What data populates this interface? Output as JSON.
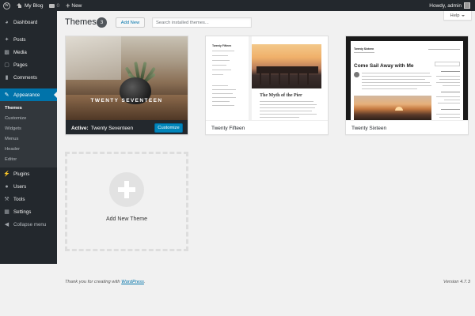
{
  "adminbar": {
    "site_name": "My Blog",
    "comments_count": "0",
    "new_label": "New",
    "greeting": "Howdy, admin"
  },
  "sidebar": {
    "items": [
      {
        "label": "Dashboard",
        "icon": "dashboard-icon"
      },
      {
        "label": "Posts",
        "icon": "pin-icon"
      },
      {
        "label": "Media",
        "icon": "media-icon"
      },
      {
        "label": "Pages",
        "icon": "page-icon"
      },
      {
        "label": "Comments",
        "icon": "comment-icon"
      },
      {
        "label": "Appearance",
        "icon": "brush-icon"
      },
      {
        "label": "Plugins",
        "icon": "plug-icon"
      },
      {
        "label": "Users",
        "icon": "users-icon"
      },
      {
        "label": "Tools",
        "icon": "wrench-icon"
      },
      {
        "label": "Settings",
        "icon": "settings-icon"
      },
      {
        "label": "Collapse menu",
        "icon": "collapse-icon"
      }
    ],
    "appearance_sub": [
      "Themes",
      "Customize",
      "Widgets",
      "Menus",
      "Header",
      "Editor"
    ]
  },
  "help": {
    "label": "Help"
  },
  "header": {
    "title": "Themes",
    "count": "3",
    "add_new_label": "Add New",
    "search_placeholder": "Search installed themes..."
  },
  "themes": [
    {
      "name": "Twenty Seventeen",
      "active_label": "Active:",
      "customize_label": "Customize",
      "screenshot_title": "TWENTY SEVENTEEN"
    },
    {
      "name": "Twenty Fifteen",
      "screenshot_post_title": "The Myth of the Pier",
      "screenshot_site_title": "Twenty Fifteen"
    },
    {
      "name": "Twenty Sixteen",
      "screenshot_post_title": "Come Sail Away with Me",
      "screenshot_site_title": "Twenty Sixteen"
    }
  ],
  "add_new_theme": {
    "label": "Add New Theme"
  },
  "footer": {
    "thanks_prefix": "Thank you for creating with",
    "wordpress_link": "WordPress",
    "thanks_suffix": ".",
    "version": "Version 4.7.3"
  },
  "colors": {
    "accent": "#0073aa",
    "sidebar_bg": "#23282d",
    "submenu_bg": "#32373c",
    "page_bg": "#f1f1f1"
  }
}
